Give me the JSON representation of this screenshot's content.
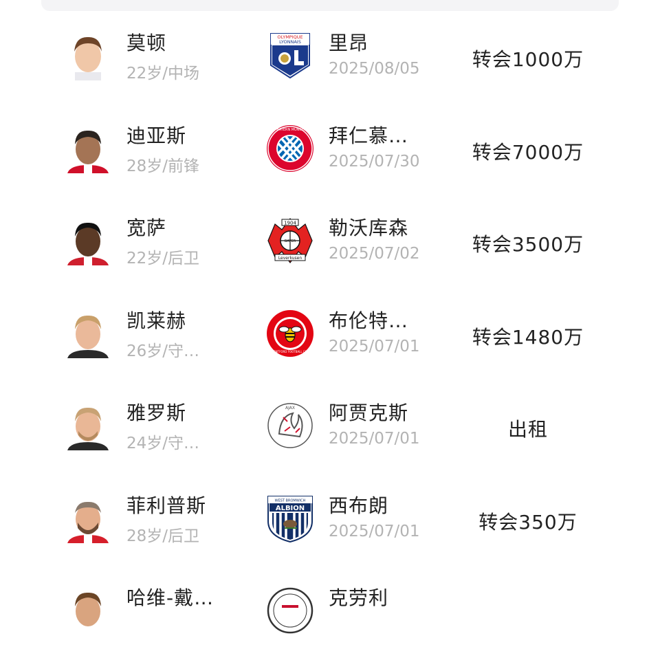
{
  "transfers": [
    {
      "player_name": "莫顿",
      "player_meta": "22岁/中场",
      "club_name": "里昂",
      "club_badge": "lyon-badge-icon",
      "date": "2025/08/05",
      "fee": "转会1000万"
    },
    {
      "player_name": "迪亚斯",
      "player_meta": "28岁/前锋",
      "club_name": "拜仁慕…",
      "club_badge": "bayern-badge-icon",
      "date": "2025/07/30",
      "fee": "转会7000万"
    },
    {
      "player_name": "宽萨",
      "player_meta": "22岁/后卫",
      "club_name": "勒沃库森",
      "club_badge": "leverkusen-badge-icon",
      "date": "2025/07/02",
      "fee": "转会3500万"
    },
    {
      "player_name": "凯莱赫",
      "player_meta": "26岁/守…",
      "club_name": "布伦特…",
      "club_badge": "brentford-badge-icon",
      "date": "2025/07/01",
      "fee": "转会1480万"
    },
    {
      "player_name": "雅罗斯",
      "player_meta": "24岁/守…",
      "club_name": "阿贾克斯",
      "club_badge": "ajax-badge-icon",
      "date": "2025/07/01",
      "fee": "出租"
    },
    {
      "player_name": "菲利普斯",
      "player_meta": "28岁/后卫",
      "club_name": "西布朗",
      "club_badge": "west-brom-badge-icon",
      "date": "2025/07/01",
      "fee": "转会350万"
    },
    {
      "player_name": "哈维-戴…",
      "player_meta": "",
      "club_name": "克劳利",
      "club_badge": "crawley-badge-icon",
      "date": "",
      "fee": ""
    }
  ],
  "badge_text": {
    "lyon": [
      "OLYMPIQUE",
      "LYONNAIS",
      "OL"
    ],
    "bayern": "FC BAYERN MÜNCHEN",
    "leverkusen": [
      "1904",
      "BAYER",
      "Leverkusen"
    ],
    "brentford": "BRENTFORD FOOTBALL CLUB",
    "ajax": "AJAX",
    "west_brom": [
      "WEST BROMWICH",
      "ALBION"
    ]
  },
  "colors": {
    "primary_text": "#222222",
    "secondary_text": "#b3b3b3",
    "lyon_blue": "#1b3a8c",
    "lyon_red": "#d71920",
    "bayern_red": "#dc052d",
    "bayern_blue": "#0066b2",
    "leverkusen_red": "#e32221",
    "brentford_red": "#e30613",
    "ajax_red": "#d2122e",
    "west_brom_navy": "#122f67"
  }
}
